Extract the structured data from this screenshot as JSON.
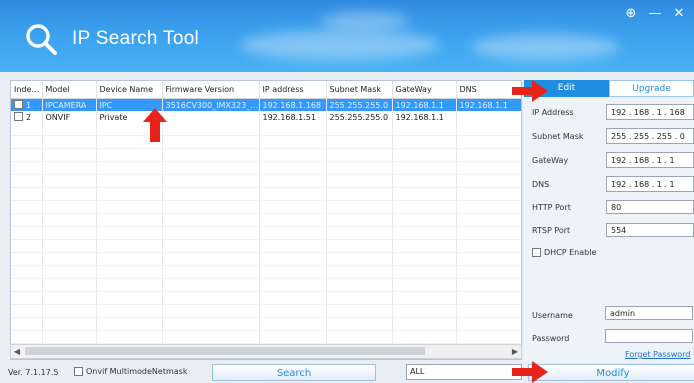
{
  "app": {
    "title": "IP Search Tool"
  },
  "window_controls": {
    "settings": "⊕",
    "minimize": "—",
    "close": "✕"
  },
  "table": {
    "headers": [
      "Inde…",
      "Model",
      "Device Name",
      "Firmware Version",
      "IP address",
      "Subnet Mask",
      "GateWay",
      "DNS"
    ],
    "rows": [
      {
        "index": "1",
        "model": "IPCAMERA",
        "device_name": "IPC",
        "firmware": "3516CV300_IMX323_…",
        "ip": "192.168.1.168",
        "mask": "255.255.255.0",
        "gateway": "192.168.1.1",
        "dns": "192.168.1.1"
      },
      {
        "index": "2",
        "model": "ONVIF",
        "device_name": "Private",
        "firmware": "",
        "ip": "192.168.1.51",
        "mask": "255.255.255.0",
        "gateway": "192.168.1.1",
        "dns": ""
      }
    ]
  },
  "tabs": {
    "edit": "Edit",
    "upgrade": "Upgrade"
  },
  "edit_form": {
    "ip_label": "IP Address",
    "ip_value": "192 . 168 . 1  . 168",
    "mask_label": "Subnet Mask",
    "mask_value": "255 . 255 . 255 .  0",
    "gateway_label": "GateWay",
    "gateway_value": "192 . 168 .  1  .  1",
    "dns_label": "DNS",
    "dns_value": "192 . 168 .  1  .  1",
    "http_label": "HTTP Port",
    "http_value": "80",
    "rtsp_label": "RTSP Port",
    "rtsp_value": "554",
    "dhcp_label": "DHCP Enable",
    "username_label": "Username",
    "username_value": "admin",
    "password_label": "Password",
    "password_value": "",
    "forgot_label": "Forget Password"
  },
  "footer": {
    "version": "Ver. 7.1.17.5",
    "multimode_label": "Onvif MultimodeNetmask",
    "search_button": "Search",
    "filter_value": "ALL",
    "modify_button": "Modify"
  },
  "colors": {
    "accent": "#1f8de0",
    "selection": "#3399ff",
    "annotation_arrow": "#e8231c"
  }
}
